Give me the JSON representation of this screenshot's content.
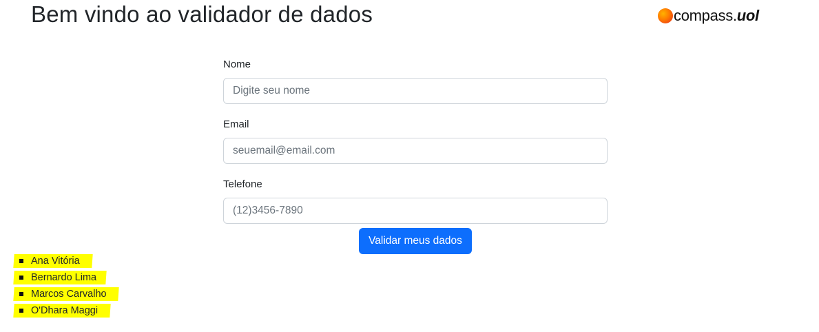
{
  "header": {
    "title": "Bem vindo ao validador de dados",
    "logo": {
      "icon": "compass-circle-icon",
      "text_main": "compass.",
      "text_bold": "uol",
      "colors": [
        "#ffb300",
        "#ff7a00",
        "#e62b1e"
      ]
    }
  },
  "form": {
    "fields": [
      {
        "label": "Nome",
        "placeholder": "Digite seu nome",
        "value": ""
      },
      {
        "label": "Email",
        "placeholder": "seuemail@email.com",
        "value": ""
      },
      {
        "label": "Telefone",
        "placeholder": "(12)3456-7890",
        "value": ""
      }
    ],
    "submit_label": "Validar meus dados",
    "submit_color": "#0d6efd"
  },
  "names": {
    "highlight_color": "#ffff00",
    "items": [
      "Ana Vitória",
      "Bernardo Lima",
      "Marcos Carvalho",
      "O'Dhara Maggi"
    ]
  }
}
